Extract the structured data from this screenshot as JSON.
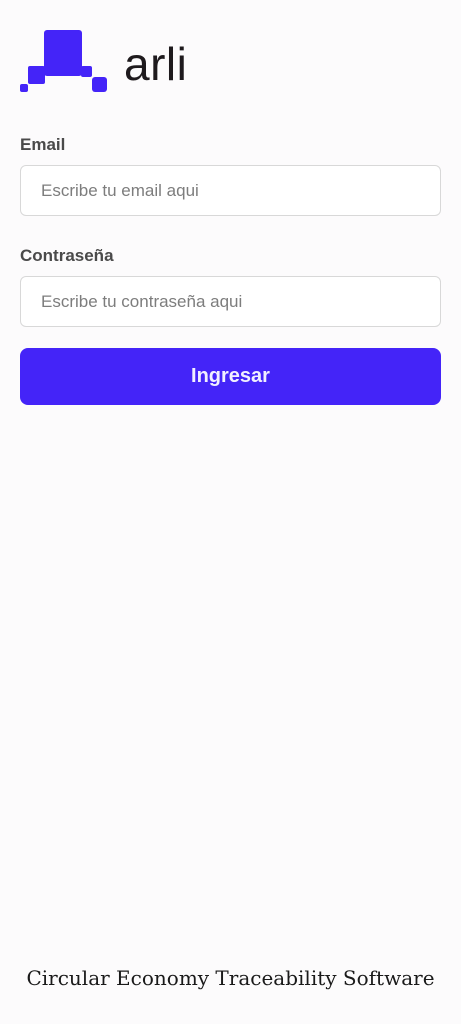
{
  "brand": {
    "name": "arli",
    "logo_icon": "arli-pixel-logo-icon",
    "accent_color": "#4424f8"
  },
  "login_form": {
    "email": {
      "label": "Email",
      "placeholder": "Escribe tu email aqui",
      "value": ""
    },
    "password": {
      "label": "Contraseña",
      "placeholder": "Escribe tu contraseña aqui",
      "value": ""
    },
    "submit_label": "Ingresar"
  },
  "footer": {
    "tagline": "Circular Economy Traceability Software"
  }
}
